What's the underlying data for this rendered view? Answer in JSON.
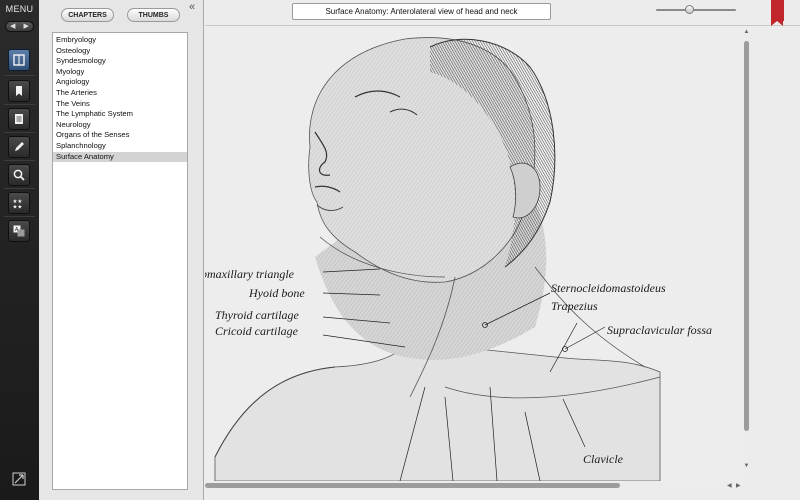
{
  "rail": {
    "menu_label": "MENU",
    "nav_prev": "◀",
    "nav_next": "▶",
    "buttons": [
      {
        "icon": "book-icon",
        "active": true
      },
      {
        "icon": "bookmark-icon",
        "active": false
      },
      {
        "icon": "notes-icon",
        "active": false
      },
      {
        "icon": "pencil-icon",
        "active": false
      },
      {
        "icon": "search-icon",
        "active": false
      },
      {
        "icon": "stars-icon",
        "active": false
      },
      {
        "icon": "translate-icon",
        "active": false
      }
    ],
    "corner_icon": "resize-icon"
  },
  "sidebar": {
    "chapters_label": "CHAPTERS",
    "thumbs_label": "THUMBS",
    "collapse_label": "«",
    "items": [
      {
        "label": "Embryology"
      },
      {
        "label": "Osteology"
      },
      {
        "label": "Syndesmology"
      },
      {
        "label": "Myology"
      },
      {
        "label": "Angiology"
      },
      {
        "label": "The Arteries"
      },
      {
        "label": "The Veins"
      },
      {
        "label": "The Lymphatic System"
      },
      {
        "label": "Neurology"
      },
      {
        "label": "Organs of the Senses"
      },
      {
        "label": "Splanchnology"
      },
      {
        "label": "Surface Anatomy",
        "selected": true
      }
    ]
  },
  "viewer": {
    "title": "Surface Anatomy: Anterolateral view of head and neck",
    "zoom_level": 0.42,
    "labels": {
      "submaxillary": "bmaxillary triangle",
      "hyoid": "Hyoid bone",
      "thyroid": "Thyroid cartilage",
      "cricoid": "Cricoid cartilage",
      "sterno": "Sternocleidomastoideus",
      "trapezius": "Trapezius",
      "supraclavicular": "Supraclavicular fossa",
      "clavicle": "Clavicle"
    }
  },
  "colors": {
    "ribbon": "#c0262a",
    "active_tool": "#3f6492"
  }
}
